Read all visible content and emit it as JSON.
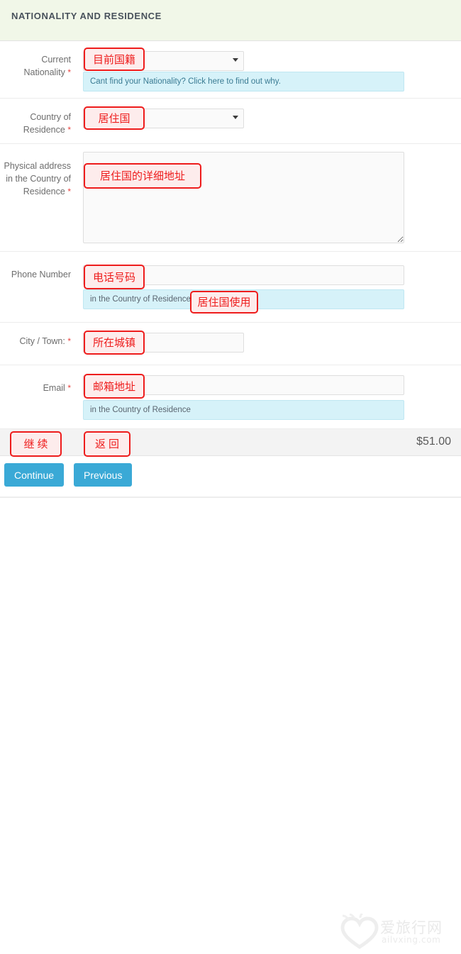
{
  "section": {
    "header_title": "NATIONALITY AND RESIDENCE"
  },
  "fields": {
    "nationality": {
      "label": "Current Nationality",
      "required_marker": "*",
      "control": "select",
      "selected_value": "",
      "hint": "Cant find your Nationality? Click here to find out why."
    },
    "country_of_residence": {
      "label": "Country of Residence",
      "required_marker": "*",
      "control": "select",
      "selected_value": ""
    },
    "physical_address": {
      "label": "Physical address in the Country of Residence",
      "required_marker": "*",
      "control": "textarea",
      "value": ""
    },
    "phone_number": {
      "label": "Phone Number",
      "required_marker": "",
      "control": "text",
      "value": "",
      "hint": "in the Country of Residence"
    },
    "city_town": {
      "label": "City / Town:",
      "required_marker": "*",
      "control": "text",
      "value": ""
    },
    "email": {
      "label": "Email",
      "required_marker": "*",
      "control": "text",
      "value": "",
      "hint": "in the Country of Residence"
    }
  },
  "footer": {
    "total_amount": "$51.00",
    "continue_label": "Continue",
    "previous_label": "Previous"
  },
  "annotations": {
    "nationality": "目前国籍",
    "country_of_residence": "居住国",
    "physical_address": "居住国的详细地址",
    "phone_number": "电话号码",
    "phone_hint": "居住国使用",
    "city_town": "所在城镇",
    "email": "邮箱地址",
    "continue_button": "继续",
    "previous_button": "返回"
  },
  "watermark": {
    "brand": "爱旅行网",
    "domain": "ailvxing.com"
  },
  "colors": {
    "header_bg": "#f1f7e8",
    "hint_bg": "#d6f2f9",
    "hint_border": "#bfe7f2",
    "button_blue": "#3aa9d6",
    "annotation_red": "#ee1c1c",
    "annotation_fill": "#fdecec",
    "required_red": "#e8433f",
    "total_bar_bg": "#f3f3f3"
  }
}
